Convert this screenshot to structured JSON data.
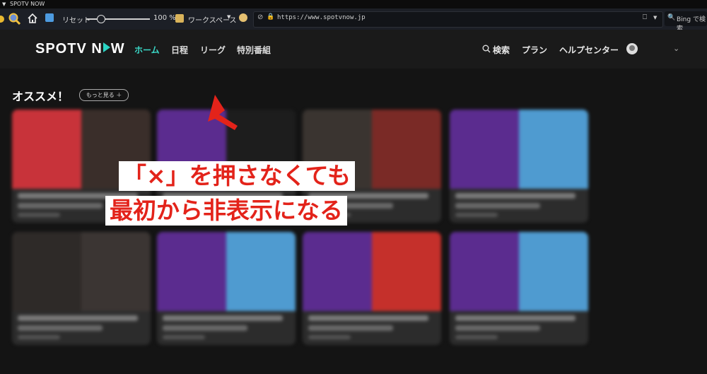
{
  "browser": {
    "window_title": "SPOTV NOW",
    "reset_label": "リセット",
    "zoom": "100 %",
    "workspace": "ワークスペース",
    "url": "https://www.spotvnow.jp",
    "search_placeholder": "Bing で検索"
  },
  "site": {
    "logo": [
      "SPOTV N",
      "W"
    ],
    "nav": [
      "ホーム",
      "日程",
      "リーグ",
      "特別番組"
    ],
    "right_nav": {
      "search": "検索",
      "plan": "プラン",
      "help": "ヘルプセンター"
    }
  },
  "section": {
    "title": "オススメ！",
    "more": "もっと見る ＋"
  },
  "annotation": {
    "line1": "「×」を押さなくても",
    "line2": "最初から非表示になる",
    "color": "#e3231a"
  },
  "cards": [
    {
      "colors": [
        "#c8333a",
        "#3a2e2a"
      ]
    },
    {
      "colors": [
        "#5b2c8f",
        "#1d1d1d"
      ]
    },
    {
      "colors": [
        "#3a3430",
        "#7a2a26"
      ]
    },
    {
      "colors": [
        "#5b2c8f",
        "#4f9bd0"
      ]
    },
    {
      "colors": [
        "#2e2a28",
        "#3b3533"
      ]
    },
    {
      "colors": [
        "#5b2c8f",
        "#4f9bd0"
      ]
    },
    {
      "colors": [
        "#5b2c8f",
        "#c5302b"
      ]
    },
    {
      "colors": [
        "#5b2c8f",
        "#4f9bd0"
      ]
    }
  ]
}
